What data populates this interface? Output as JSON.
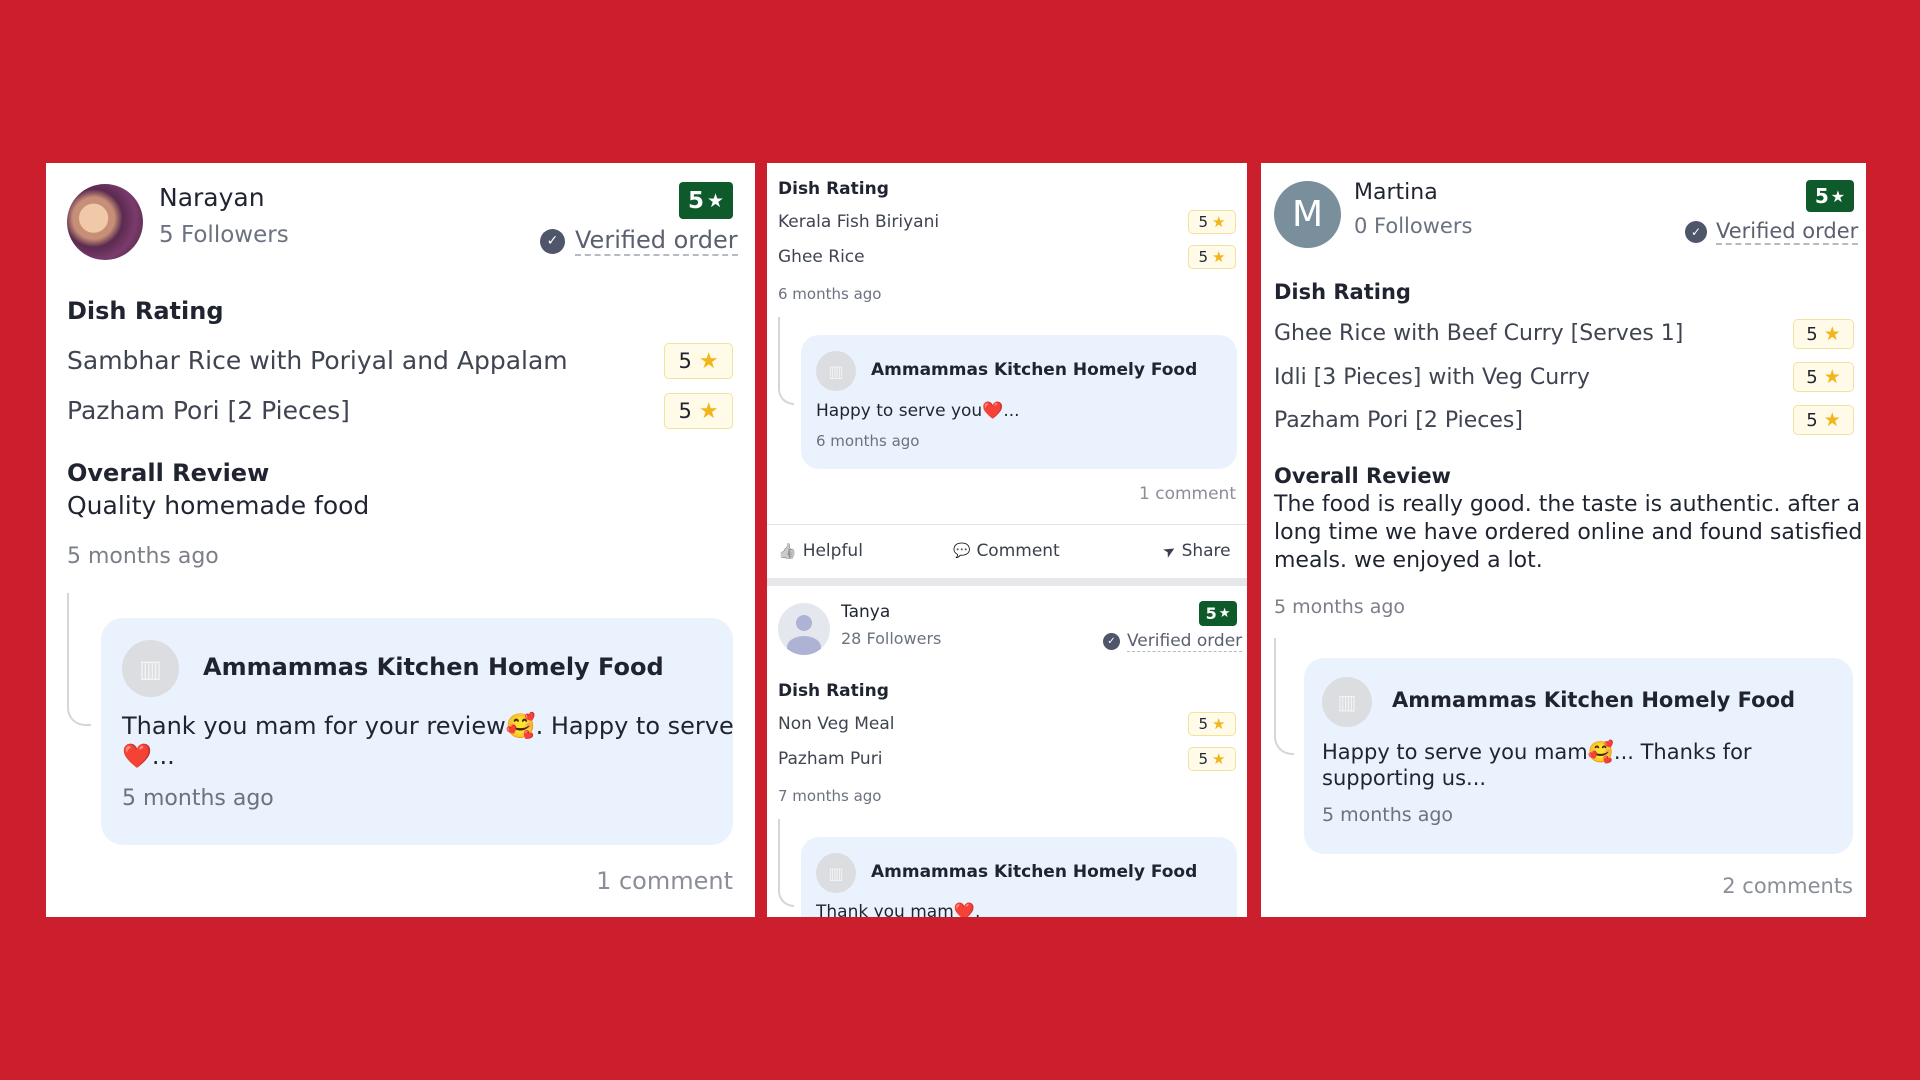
{
  "colors": {
    "background": "#cc1f2e",
    "overall_rating_badge": "#0f5a2a",
    "dish_rating_star": "#f2b51a",
    "reply_background": "#eaf2fd"
  },
  "reviews": [
    {
      "reviewer": {
        "name": "Narayan",
        "followers": "5 Followers",
        "avatar": "photo"
      },
      "overall_rating": "5",
      "rating_star_icon": "★",
      "verified_label": "Verified order",
      "dish_rating_label": "Dish Rating",
      "dishes": [
        {
          "name": "Sambhar Rice with Poriyal and Appalam",
          "rating": "5"
        },
        {
          "name": "Pazham Pori [2 Pieces]",
          "rating": "5"
        }
      ],
      "overall_review_label": "Overall Review",
      "overall_review_text": "Quality homemade food",
      "time_ago": "5 months ago",
      "reply": {
        "shop_name": "Ammammas Kitchen Homely Food",
        "text_line1": "Thank you mam for your review🥰. Happy to serve",
        "text_line2": "❤️...",
        "time_ago": "5 months ago"
      },
      "comments_count": "1 comment"
    },
    {
      "dish_rating_label": "Dish Rating",
      "dishes": [
        {
          "name": "Kerala Fish Biriyani",
          "rating": "5"
        },
        {
          "name": "Ghee Rice",
          "rating": "5"
        }
      ],
      "time_ago": "6 months ago",
      "reply": {
        "shop_name": "Ammammas Kitchen Homely Food",
        "text_line1": "Happy to serve you❤️...",
        "time_ago": "6 months ago"
      },
      "comments_count": "1 comment",
      "actions": {
        "helpful": "Helpful",
        "comment": "Comment",
        "share": "Share"
      }
    },
    {
      "reviewer": {
        "name": "Tanya",
        "followers": "28 Followers",
        "avatar": "default"
      },
      "overall_rating": "5",
      "rating_star_icon": "★",
      "verified_label": "Verified order",
      "dish_rating_label": "Dish Rating",
      "dishes": [
        {
          "name": "Non Veg Meal",
          "rating": "5"
        },
        {
          "name": "Pazham Puri",
          "rating": "5"
        }
      ],
      "time_ago": "7 months ago",
      "reply": {
        "shop_name": "Ammammas Kitchen Homely Food",
        "text_line1": "Thank you mam❤️."
      }
    },
    {
      "reviewer": {
        "name": "Martina",
        "followers": "0 Followers",
        "avatar": "letter",
        "initial": "M"
      },
      "overall_rating": "5",
      "rating_star_icon": "★",
      "verified_label": "Verified order",
      "dish_rating_label": "Dish Rating",
      "dishes": [
        {
          "name": "Ghee Rice with Beef Curry [Serves 1]",
          "rating": "5"
        },
        {
          "name": "Idli [3 Pieces] with Veg Curry",
          "rating": "5"
        },
        {
          "name": "Pazham Pori [2 Pieces]",
          "rating": "5"
        }
      ],
      "overall_review_label": "Overall Review",
      "overall_review_lines": [
        "The food is really good. the taste is authentic. after a",
        "long time we have ordered online and found satisfied",
        "meals. we enjoyed a lot."
      ],
      "time_ago": "5 months ago",
      "reply": {
        "shop_name": "Ammammas Kitchen Homely Food",
        "text_line1": "Happy to serve you mam🥰... Thanks for",
        "text_line2": "supporting us...",
        "time_ago": "5 months ago"
      },
      "comments_count": "2 comments"
    }
  ],
  "icons": {
    "star": "★",
    "check": "✓",
    "shop": "▥",
    "helpful": "👍",
    "comment": "💬",
    "share": "➤"
  }
}
